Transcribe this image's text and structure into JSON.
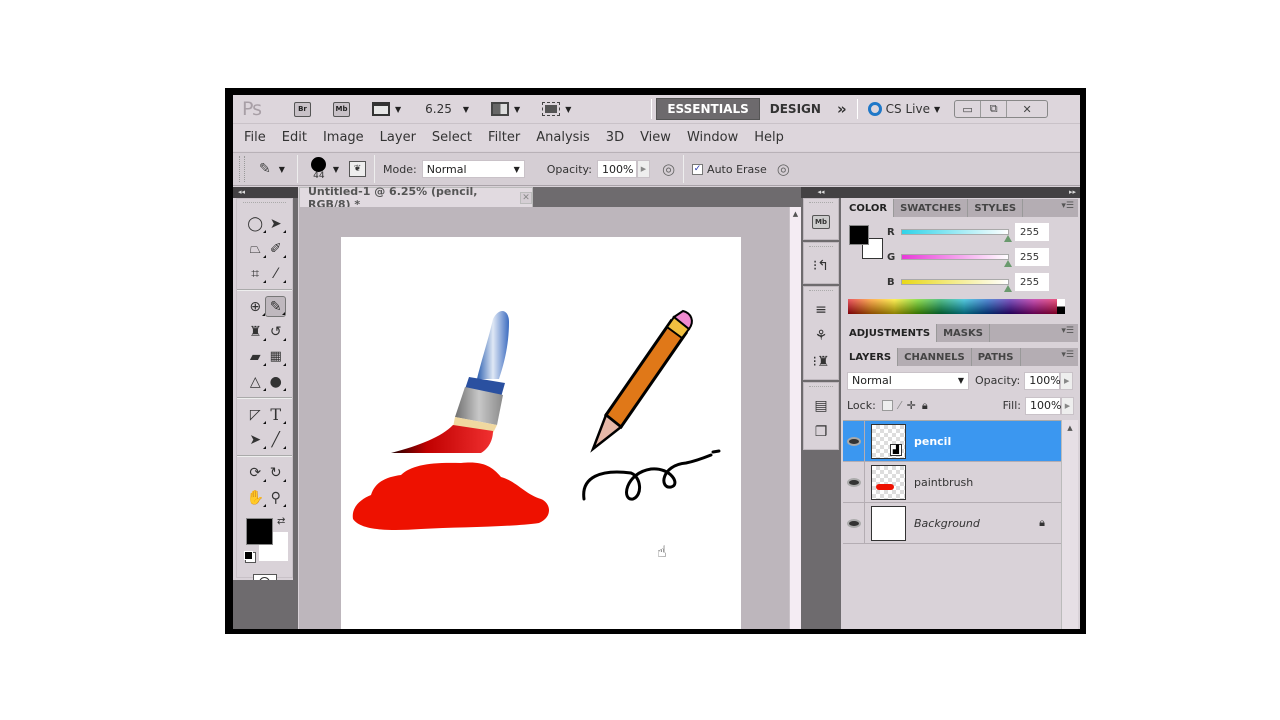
{
  "appbar": {
    "logo": "Ps",
    "bridge_label": "Br",
    "minibridge_label": "Mb",
    "zoom_level": "6.25",
    "workspaces": [
      "ESSENTIALS",
      "DESIGN"
    ],
    "more_label": "»",
    "cslive_label": "CS Live",
    "window_controls": {
      "minimize": "▭",
      "restore": "⧉",
      "close": "✕"
    }
  },
  "menu": [
    "File",
    "Edit",
    "Image",
    "Layer",
    "Select",
    "Filter",
    "Analysis",
    "3D",
    "View",
    "Window",
    "Help"
  ],
  "options": {
    "brush_size": "44",
    "mode_label": "Mode:",
    "mode_value": "Normal",
    "opacity_label": "Opacity:",
    "opacity_value": "100%",
    "auto_erase_label": "Auto Erase",
    "auto_erase_checked": true
  },
  "document": {
    "tab_title": "Untitled-1 @ 6.25% (pencil, RGB/8) *",
    "close_label": "✕"
  },
  "color_panel": {
    "tabs": [
      "COLOR",
      "SWATCHES",
      "STYLES"
    ],
    "sliders": [
      {
        "label": "R",
        "value": "255",
        "color": "#2fd3e8"
      },
      {
        "label": "G",
        "value": "255",
        "color": "#e83ad8"
      },
      {
        "label": "B",
        "value": "255",
        "color": "#e8d818"
      }
    ],
    "foreground": "#000000",
    "background": "#ffffff"
  },
  "adjustments_panel": {
    "tabs": [
      "ADJUSTMENTS",
      "MASKS"
    ]
  },
  "layers_panel": {
    "tabs": [
      "LAYERS",
      "CHANNELS",
      "PATHS"
    ],
    "blend_mode": "Normal",
    "opacity_label": "Opacity:",
    "opacity_value": "100%",
    "lock_label": "Lock:",
    "fill_label": "Fill:",
    "fill_value": "100%",
    "layers": [
      {
        "name": "pencil",
        "selected": true
      },
      {
        "name": "paintbrush",
        "selected": false
      },
      {
        "name": "Background",
        "selected": false,
        "locked": true
      }
    ]
  },
  "colors": {
    "selection": "#3b97f0",
    "paint_red": "#ee1100"
  }
}
